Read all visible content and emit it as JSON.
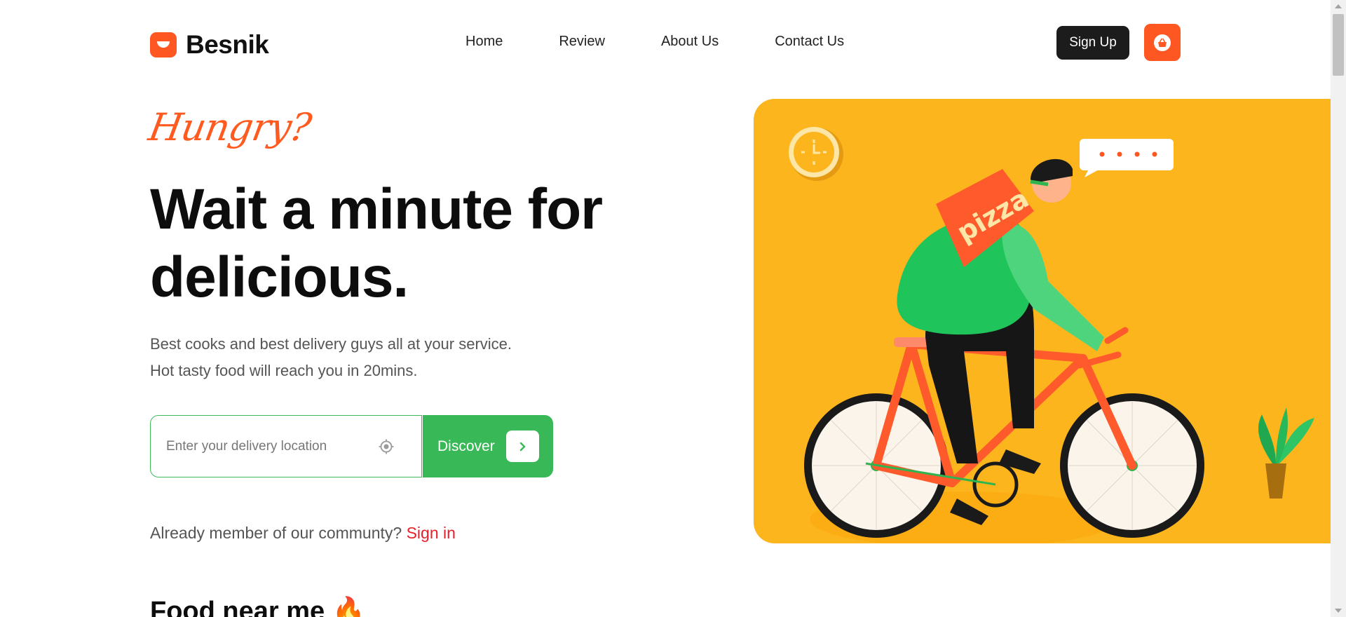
{
  "brand": {
    "name": "Besnik",
    "accent": "#ff5722",
    "logo_icon": "bowl-icon"
  },
  "nav": {
    "items": [
      "Home",
      "Review",
      "About Us",
      "Contact Us"
    ]
  },
  "header": {
    "signup_label": "Sign Up",
    "cart_icon": "basket-icon"
  },
  "hero": {
    "tagline": "Hungry?",
    "headline_line1": "Wait a minute for",
    "headline_line2": "delicious.",
    "subtext_line1": "Best cooks and best delivery guys all at your service.",
    "subtext_line2": "Hot tasty food will reach you in 20mins.",
    "illustration_text": "pizza",
    "illustration_bg": "#fdb51e"
  },
  "search": {
    "placeholder": "Enter your delivery location",
    "location_icon": "crosshair-icon",
    "button_label": "Discover",
    "button_icon": "chevron-right-icon",
    "button_color": "#38b856"
  },
  "member": {
    "prompt": "Already member of our communty?",
    "signin_label": "Sign in",
    "signin_color": "#e8202a"
  },
  "section": {
    "food_title": "Food near me 🔥"
  }
}
